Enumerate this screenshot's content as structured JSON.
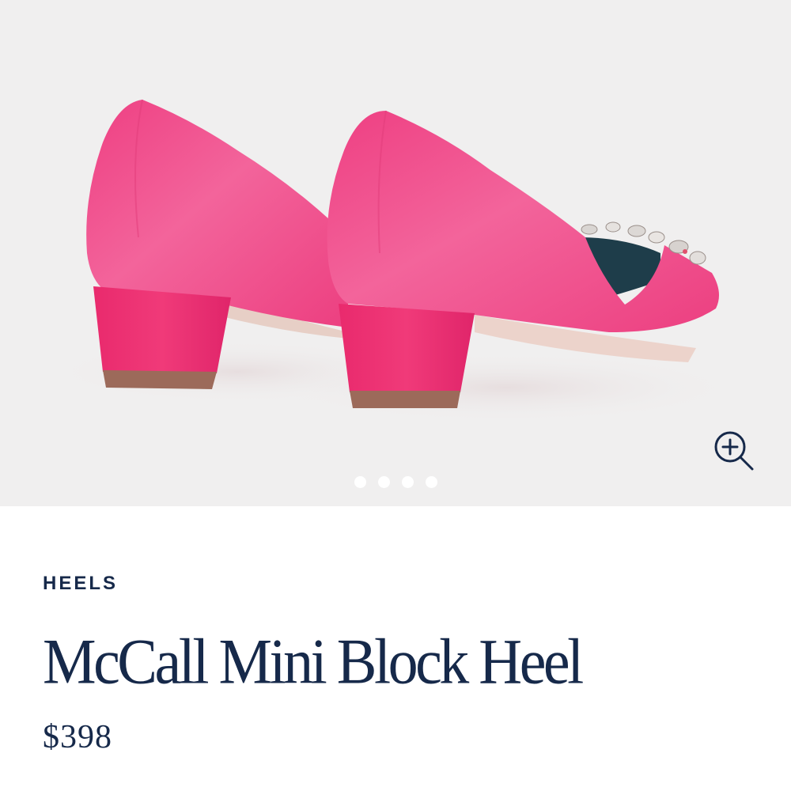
{
  "product": {
    "category": "HEELS",
    "title": "McCall Mini Block Heel",
    "price": "$398"
  },
  "gallery": {
    "image_count": 4,
    "active_index": 0,
    "zoom_icon": "zoom-in-icon"
  },
  "colors": {
    "text": "#16294a",
    "gallery_background": "#f0efef",
    "shoe_pink": "#f0508d",
    "heel_pink": "#ec2f73"
  }
}
